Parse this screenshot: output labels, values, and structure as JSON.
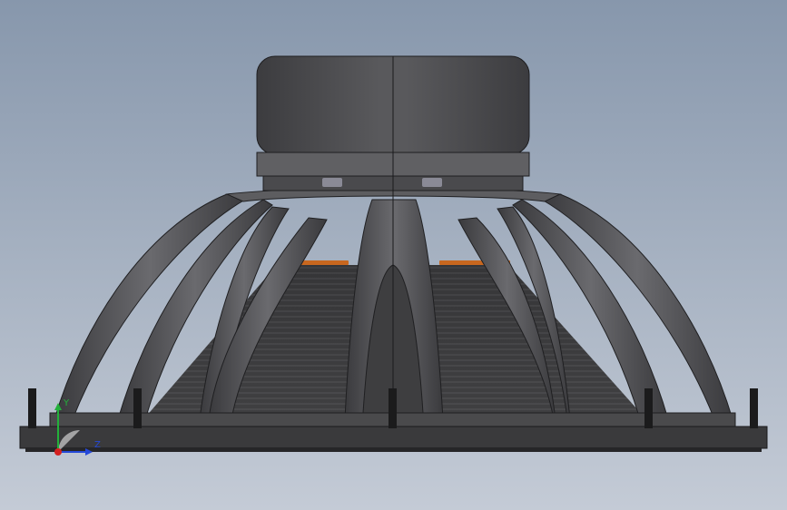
{
  "viewport": {
    "background_top": "#8797ac",
    "background_bottom": "#c4cbd6"
  },
  "model": {
    "magnet_color": "#4a4a4d",
    "basket_color": "#4f4f52",
    "cone_color": "#3c3c3e",
    "accent_color": "#c8671f",
    "frame_color": "#3a3a3c"
  },
  "triad": {
    "x_color": "#2448d8",
    "y_color": "#22b03a",
    "origin_color": "#d42020",
    "x_label": "Z",
    "y_label": "Y"
  }
}
